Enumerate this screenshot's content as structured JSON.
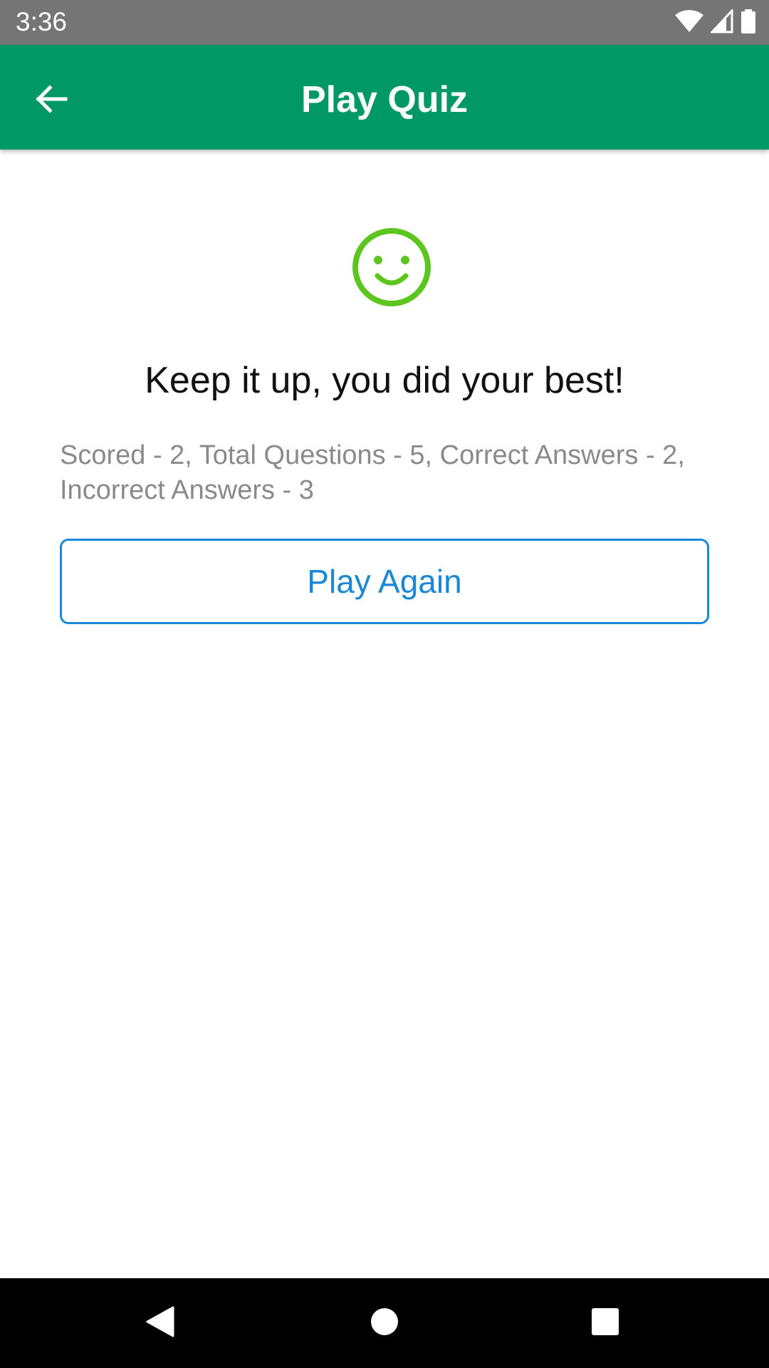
{
  "status_bar": {
    "time": "3:36",
    "icons": [
      "wifi-icon",
      "signal-icon",
      "battery-icon"
    ]
  },
  "toolbar": {
    "title": "Play Quiz",
    "back_icon": "arrow-back-icon",
    "background_color": "#009966"
  },
  "result": {
    "icon": "smiley-face-icon",
    "icon_color": "#5cc61e",
    "title": "Keep it up, you did your best!",
    "summary": "Scored - 2, Total Questions - 5, Correct Answers - 2, Incorrect Answers - 3",
    "play_again_label": "Play Again",
    "accent_color": "#1a88d8"
  },
  "nav_bar": {
    "buttons": [
      "back-triangle-icon",
      "home-circle-icon",
      "recents-square-icon"
    ]
  }
}
